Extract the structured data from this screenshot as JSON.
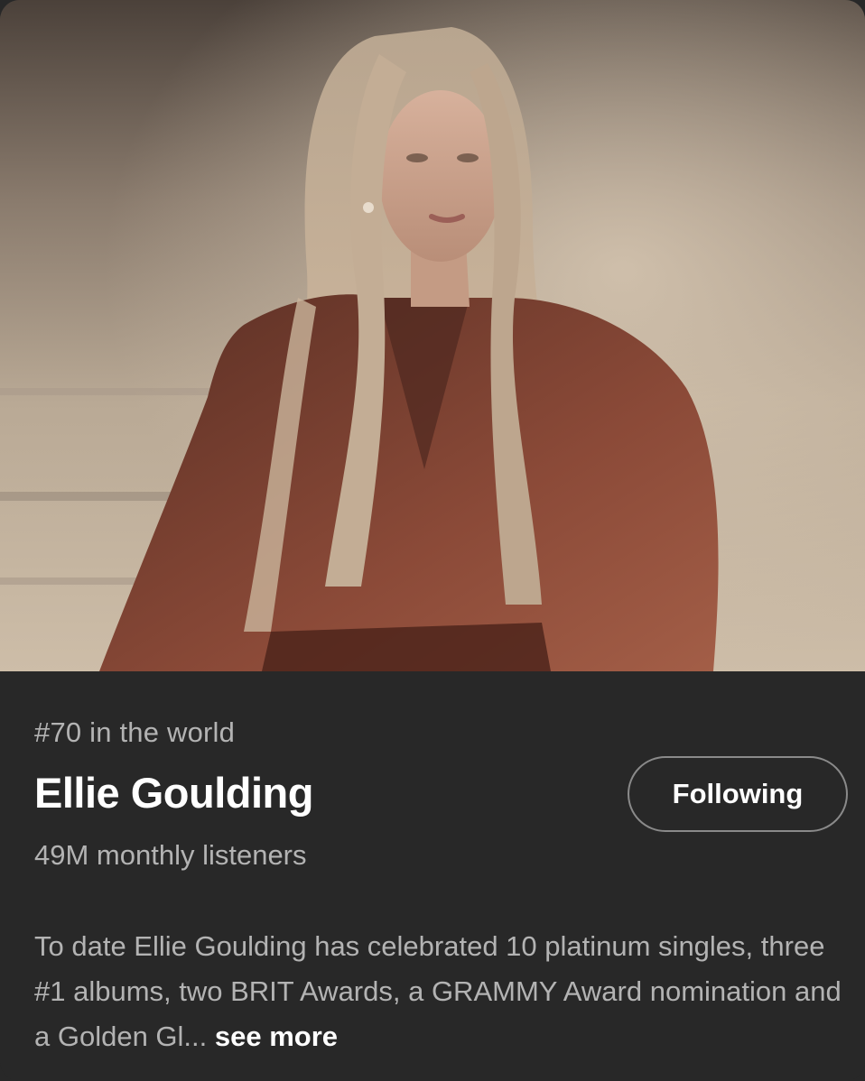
{
  "artist": {
    "rank_text": "#70 in the world",
    "name": "Ellie Goulding",
    "monthly_listeners": "49M monthly listeners",
    "follow_button_label": "Following",
    "bio_text": "To date Ellie Goulding has celebrated 10 platinum singles, three #1 albums, two BRIT Awards, a GRAMMY Award nomination and a Golden Gl...",
    "see_more_label": "see more"
  },
  "colors": {
    "background": "#282828",
    "primary_text": "#ffffff",
    "secondary_text": "#b3b3b3",
    "button_border": "#8a8a8a"
  }
}
